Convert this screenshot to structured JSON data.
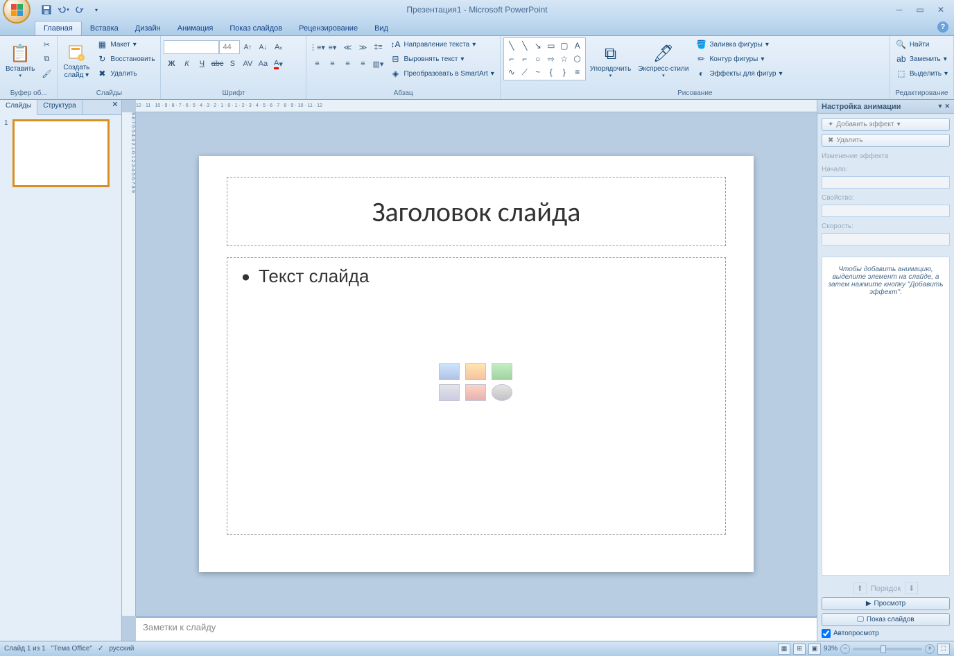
{
  "title": "Презентация1 - Microsoft PowerPoint",
  "qat": {
    "save": "save-icon",
    "undo": "undo-icon",
    "redo": "redo-icon"
  },
  "tabs": [
    "Главная",
    "Вставка",
    "Дизайн",
    "Анимация",
    "Показ слайдов",
    "Рецензирование",
    "Вид"
  ],
  "active_tab": 0,
  "ribbon": {
    "clipboard": {
      "label": "Буфер об...",
      "paste": "Вставить"
    },
    "slides": {
      "label": "Слайды",
      "new": "Создать\nслайд",
      "layout": "Макет",
      "reset": "Восстановить",
      "delete": "Удалить"
    },
    "font": {
      "label": "Шрифт",
      "name_placeholder": "",
      "size": "44"
    },
    "paragraph": {
      "label": "Абзац",
      "direction": "Направление текста",
      "align": "Выровнять текст",
      "smartart": "Преобразовать в SmartArt"
    },
    "drawing": {
      "label": "Рисование",
      "arrange": "Упорядочить",
      "styles": "Экспресс-стили",
      "fill": "Заливка фигуры",
      "outline": "Контур фигуры",
      "effects": "Эффекты для фигур"
    },
    "editing": {
      "label": "Редактирование",
      "find": "Найти",
      "replace": "Заменить",
      "select": "Выделить"
    }
  },
  "left_panel": {
    "tabs": [
      "Слайды",
      "Структура"
    ],
    "active": 0,
    "thumb_num": "1"
  },
  "slide": {
    "title": "Заголовок слайда",
    "content": "Текст слайда"
  },
  "notes_placeholder": "Заметки к слайду",
  "anim_panel": {
    "title": "Настройка анимации",
    "add": "Добавить эффект",
    "remove": "Удалить",
    "change": "Изменение эффекта",
    "start": "Начало:",
    "property": "Свойство:",
    "speed": "Скорость:",
    "hint": "Чтобы добавить анимацию, выделите элемент на слайде, а затем нажмите кнопку \"Добавить эффект\".",
    "order": "Порядок",
    "preview": "Просмотр",
    "slideshow": "Показ слайдов",
    "autopreview": "Автопросмотр"
  },
  "status": {
    "slide": "Слайд 1 из 1",
    "theme": "\"Тема Office\"",
    "lang": "русский",
    "zoom": "93%"
  },
  "ruler_h": "12 · 11 · 10 · 9 · 8 · 7 · 6 · 5 · 4 · 3 · 2 · 1 · 0 · 1 · 2 · 3 · 4 · 5 · 6 · 7 · 8 · 9 · 10 · 11 · 12",
  "ruler_v": "9·8·7·6·5·4·3·2·1·0·1·2·3·4·5·6·7·8·9"
}
